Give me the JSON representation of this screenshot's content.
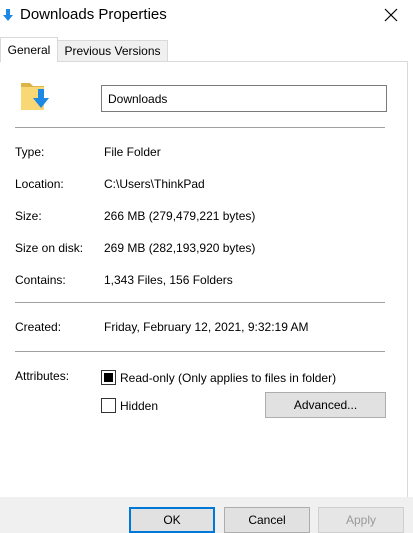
{
  "window": {
    "title": "Downloads Properties",
    "icon": "downloads-folder-icon"
  },
  "tabs": [
    {
      "label": "General",
      "active": true
    },
    {
      "label": "Previous Versions",
      "active": false
    }
  ],
  "general": {
    "name": "Downloads",
    "fields": {
      "type": {
        "label": "Type:",
        "value": "File Folder"
      },
      "location": {
        "label": "Location:",
        "value": "C:\\Users\\ThinkPad"
      },
      "size": {
        "label": "Size:",
        "value": "266 MB (279,479,221 bytes)"
      },
      "size_on_disk": {
        "label": "Size on disk:",
        "value": "269 MB (282,193,920 bytes)"
      },
      "contains": {
        "label": "Contains:",
        "value": "1,343 Files, 156 Folders"
      },
      "created": {
        "label": "Created:",
        "value": "Friday, February 12, 2021, 9:32:19 AM"
      }
    },
    "attributes": {
      "label": "Attributes:",
      "read_only": {
        "label": "Read-only (Only applies to files in folder)",
        "state": "indeterminate"
      },
      "hidden": {
        "label": "Hidden",
        "checked": false
      },
      "advanced_label": "Advanced..."
    }
  },
  "buttons": {
    "ok": "OK",
    "cancel": "Cancel",
    "apply": "Apply"
  },
  "colors": {
    "accent": "#0078d7",
    "folder_yellow": "#f8d775",
    "arrow_blue": "#1e88e5"
  }
}
